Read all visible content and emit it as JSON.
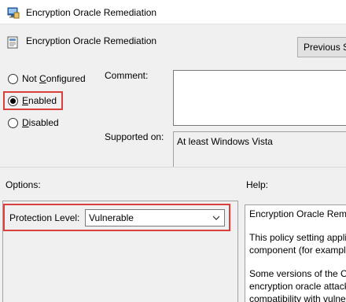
{
  "window": {
    "title": "Encryption Oracle Remediation"
  },
  "header": {
    "setting_name": "Encryption Oracle Remediation",
    "previous_button": "Previous S"
  },
  "state": {
    "not_configured": {
      "prefix": "Not ",
      "accel": "C",
      "suffix": "onfigured",
      "selected": false
    },
    "enabled": {
      "prefix": "",
      "accel": "E",
      "suffix": "nabled",
      "selected": true
    },
    "disabled": {
      "prefix": "",
      "accel": "D",
      "suffix": "isabled",
      "selected": false
    }
  },
  "comment": {
    "label": "Comment:",
    "value": ""
  },
  "supported_on": {
    "label": "Supported on:",
    "value": "At least Windows Vista"
  },
  "options": {
    "label": "Options:",
    "protection_level_label": "Protection Level:",
    "protection_level_value": "Vulnerable"
  },
  "help": {
    "label": "Help:",
    "lines": [
      "Encryption Oracle Reme",
      "This policy setting appli",
      "component (for exampl",
      "Some versions of the Cr",
      "encryption oracle attack",
      "compatibility with vulne"
    ]
  },
  "colors": {
    "highlight": "#d9403d",
    "window_bg": "#f0f0f0"
  }
}
